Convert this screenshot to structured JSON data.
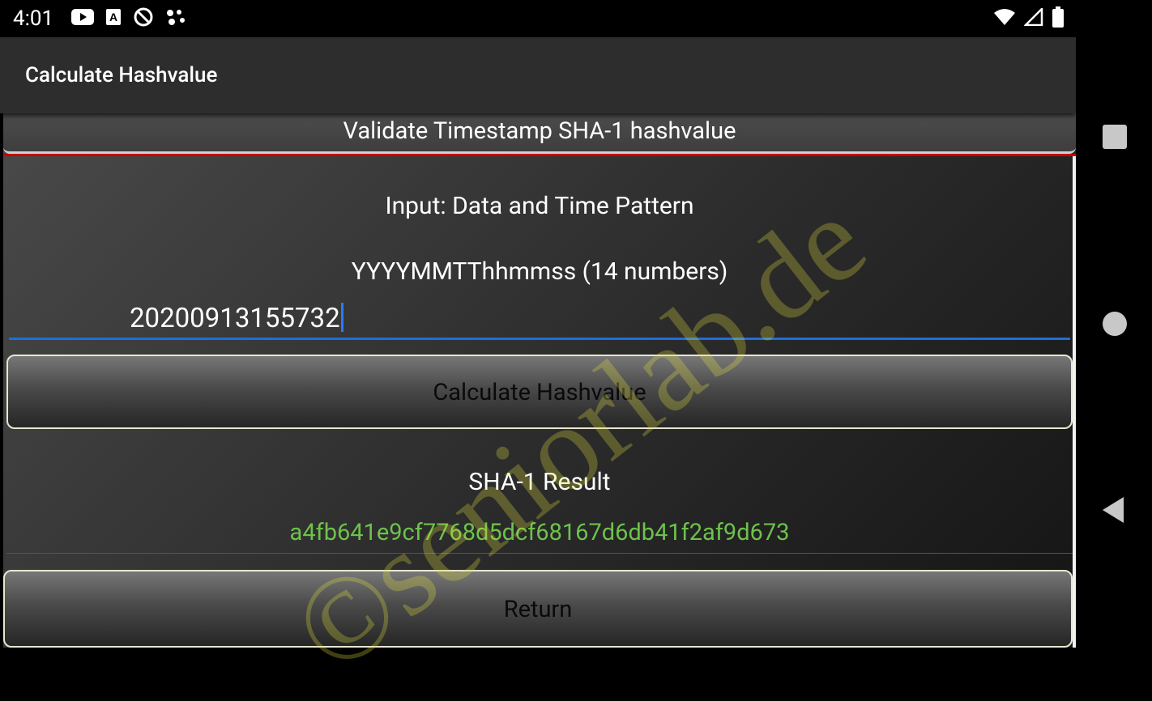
{
  "status_bar": {
    "time": "4:01",
    "left_icons": [
      "youtube-icon",
      "text-a-icon",
      "no-disturb-icon",
      "assistant-dots-icon"
    ],
    "right_icons": [
      "wifi-icon",
      "cellular-signal-icon",
      "battery-icon"
    ]
  },
  "app_bar": {
    "title": "Calculate Hashvalue"
  },
  "main": {
    "validate_button_label": "Validate Timestamp SHA-1 hashvalue",
    "input_label": "Input: Data and Time Pattern",
    "pattern_hint": "YYYYMMTThhmmss (14 numbers)",
    "timestamp_value": "20200913155732",
    "calculate_button_label": "Calculate Hashvalue",
    "result_label": "SHA-1 Result",
    "result_value": "a4fb641e9cf7768d5dcf68167d6db41f2af9d673",
    "return_button_label": "Return"
  },
  "watermark": "©seniorlab.de",
  "nav_bar": {
    "icons": [
      "recent-apps-icon",
      "home-icon",
      "back-icon"
    ]
  },
  "colors": {
    "accent": "#1e6fd9",
    "result_text": "#6ec24c",
    "red_line": "#c80000"
  }
}
